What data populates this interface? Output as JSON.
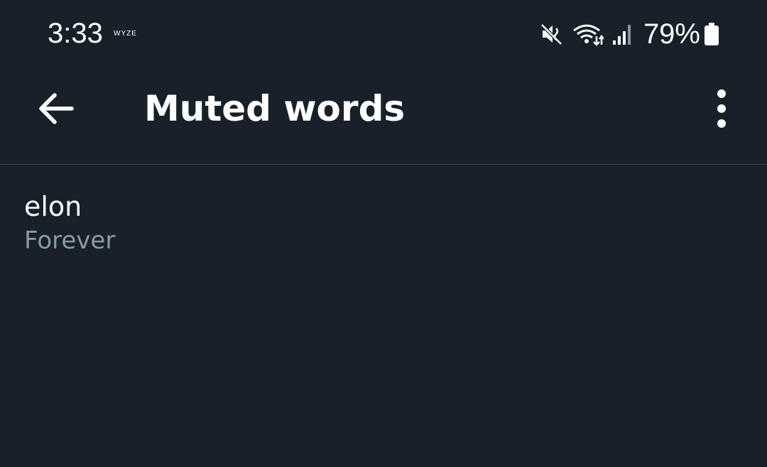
{
  "status_bar": {
    "time": "3:33",
    "notification_label": "WYZE",
    "battery_percent": "79%",
    "icons": [
      "wyze-icon",
      "mute-icon",
      "wifi-icon",
      "signal-icon",
      "battery-icon"
    ]
  },
  "app_bar": {
    "title": "Muted words",
    "back_icon": "arrow-left-icon",
    "menu_icon": "more-vertical-icon"
  },
  "muted_words": [
    {
      "word": "elon",
      "duration": "Forever"
    }
  ],
  "colors": {
    "background": "#18202a",
    "text_primary": "#ffffff",
    "text_secondary": "#8b98a5",
    "divider": "#3b4651"
  }
}
